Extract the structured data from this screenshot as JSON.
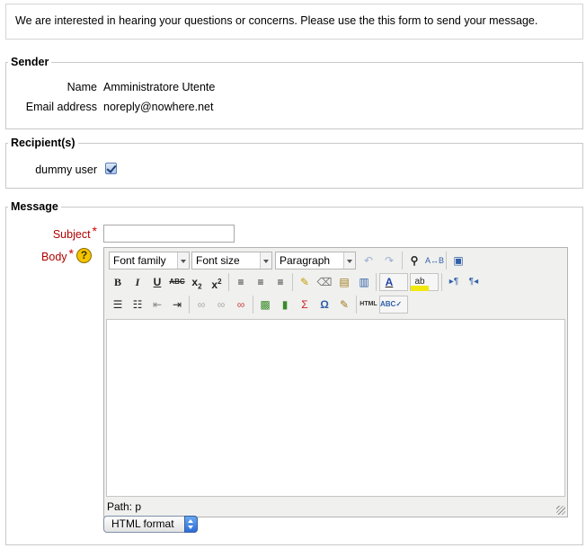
{
  "intro": {
    "text": "We are interested in hearing your questions or concerns. Please use the this form to send your message."
  },
  "sender": {
    "legend": "Sender",
    "name_label": "Name",
    "name_value": "Amministratore Utente",
    "email_label": "Email address",
    "email_value": "noreply@nowhere.net"
  },
  "recipients": {
    "legend": "Recipient(s)",
    "items": [
      {
        "label": "dummy user",
        "checked": true
      }
    ]
  },
  "message": {
    "legend": "Message",
    "subject_label": "Subject",
    "subject_value": "",
    "body_label": "Body",
    "required_mark": "*",
    "help_text": "?"
  },
  "editor": {
    "font_family": "Font family",
    "font_size": "Font size",
    "paragraph": "Paragraph",
    "path_label": "Path: p",
    "buttons_row1": [
      "undo-icon",
      "redo-icon",
      "find-icon",
      "replace-icon",
      "fullscreen-icon"
    ],
    "buttons_row2": [
      "bold-icon",
      "italic-icon",
      "underline-icon",
      "strikethrough-icon",
      "subscript-icon",
      "superscript-icon",
      "align-left-icon",
      "align-center-icon",
      "align-right-icon",
      "cleanup-icon",
      "remove-format-icon",
      "paste-text-icon",
      "paste-word-icon",
      "text-color-icon",
      "highlight-icon",
      "ltr-icon",
      "rtl-icon"
    ],
    "buttons_row3": [
      "bullet-list-icon",
      "numbered-list-icon",
      "outdent-icon",
      "indent-icon",
      "link-icon",
      "unlink-icon",
      "anchor-icon",
      "image-icon",
      "media-icon",
      "equation-icon",
      "special-char-icon",
      "notes-icon",
      "html-source-icon",
      "spellcheck-icon"
    ]
  },
  "format": {
    "selected": "HTML format"
  },
  "colors": {
    "required": "#b00000",
    "border": "#c9c9c9",
    "editor_bg": "#f0f0ee"
  }
}
